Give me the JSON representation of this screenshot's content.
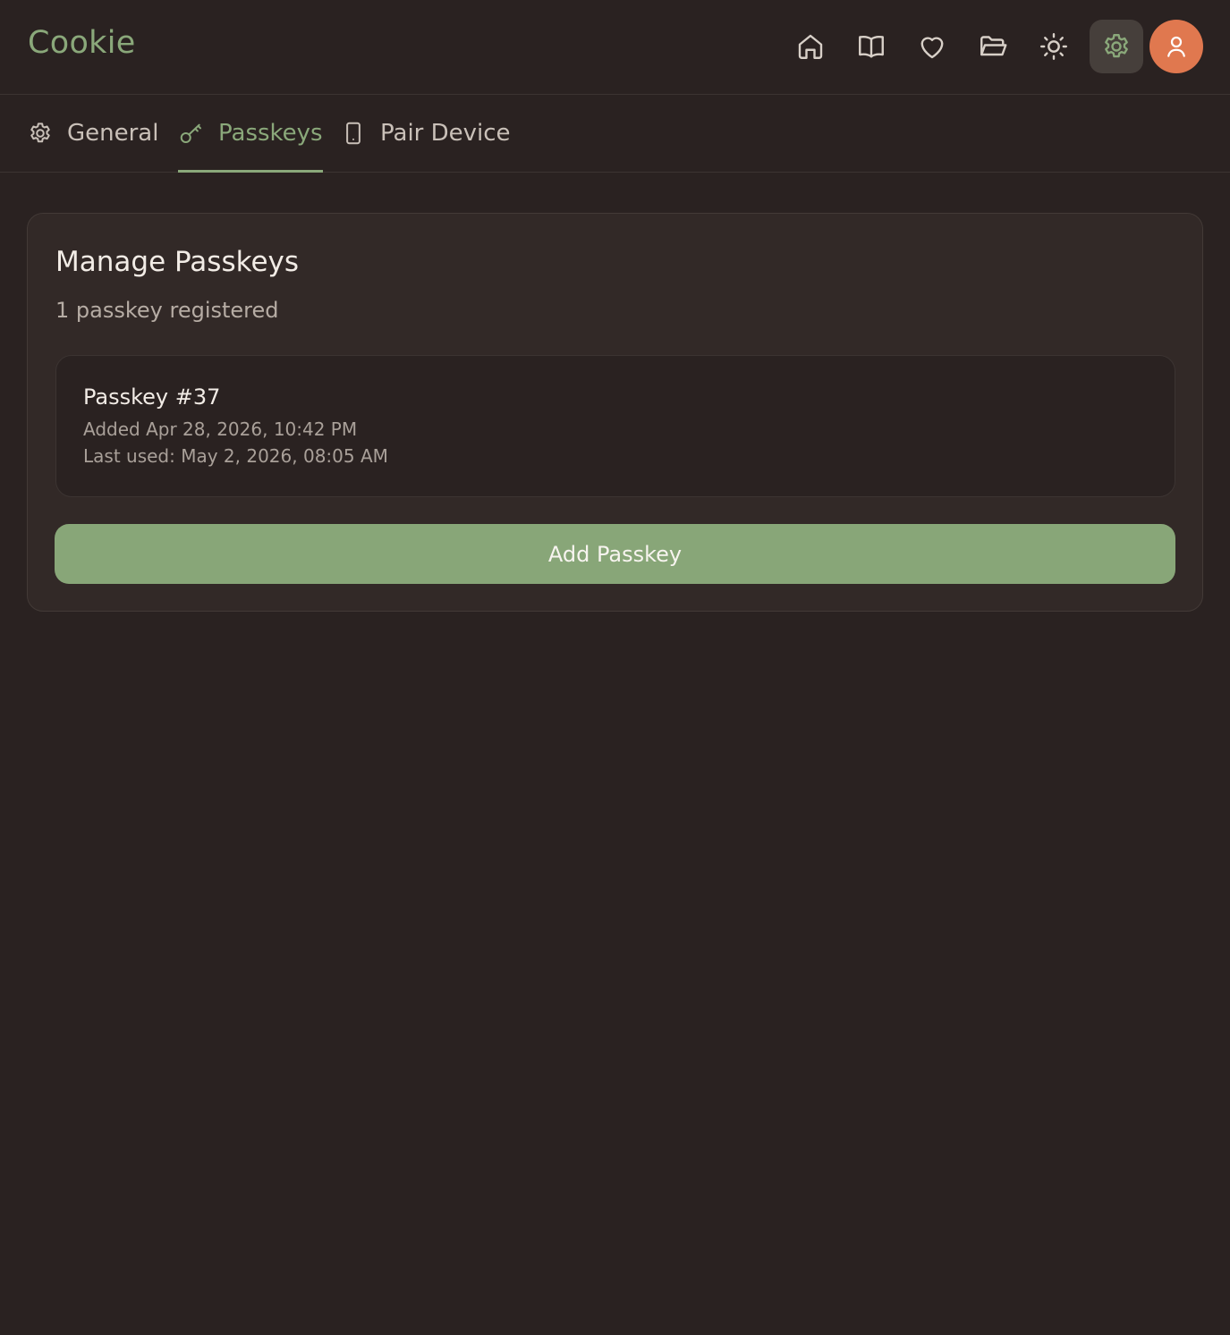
{
  "app": {
    "title": "Cookie"
  },
  "colors": {
    "background": "#2a2221",
    "accent": "#8aa87a",
    "avatar": "#e0784f",
    "card": "#322927"
  },
  "nav": {
    "icons": [
      "home-icon",
      "book-icon",
      "heart-icon",
      "folder-icon",
      "sun-icon",
      "settings-icon",
      "user-icon"
    ],
    "active": "settings-icon"
  },
  "tabs": [
    {
      "label": "General",
      "icon": "gear-icon",
      "active": false
    },
    {
      "label": "Passkeys",
      "icon": "key-icon",
      "active": true
    },
    {
      "label": "Pair Device",
      "icon": "phone-icon",
      "active": false
    }
  ],
  "passkeys": {
    "title": "Manage Passkeys",
    "count_text": "1 passkey registered",
    "items": [
      {
        "name": "Passkey #37",
        "added": "Added Apr 28, 2026, 10:42 PM",
        "last_used": "Last used: May 2, 2026, 08:05 AM"
      }
    ],
    "add_button": "Add Passkey"
  }
}
